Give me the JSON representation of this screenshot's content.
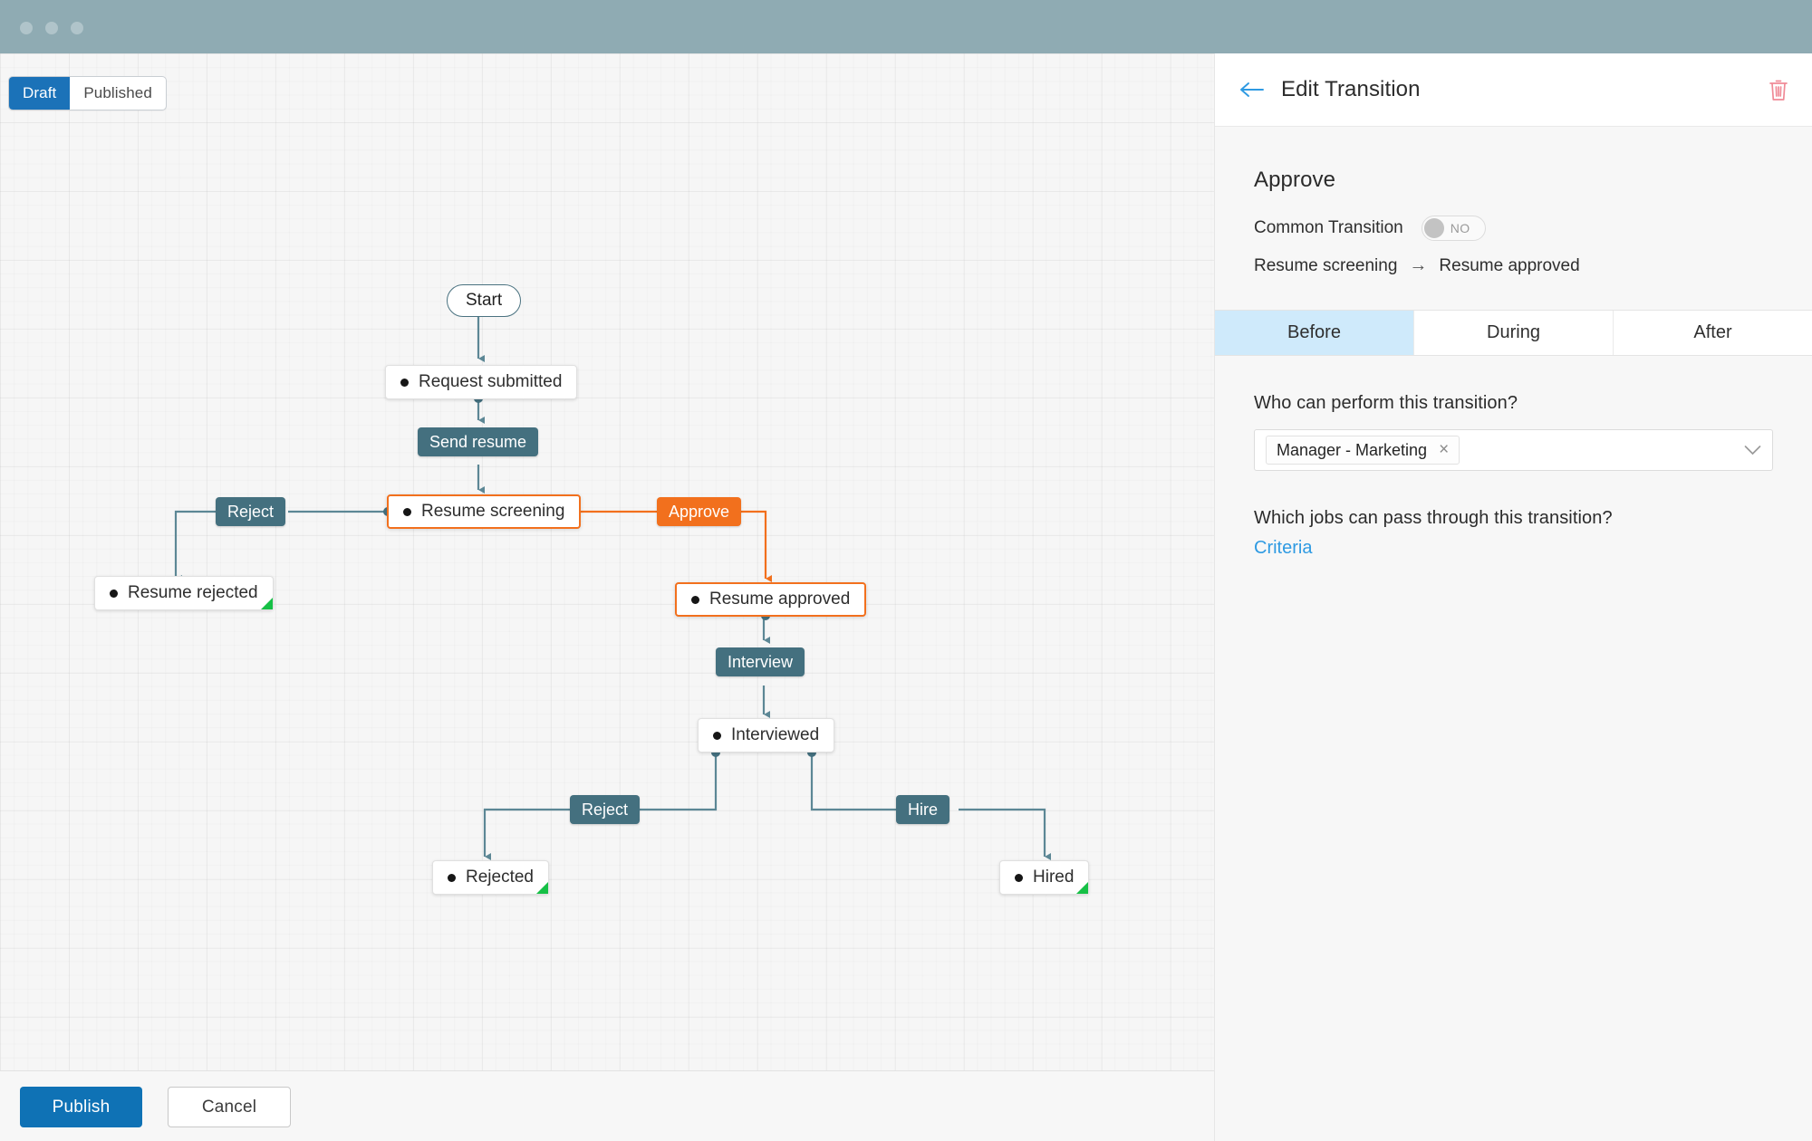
{
  "window": {
    "dots": [
      "close-dot",
      "minimize-dot",
      "maximize-dot"
    ]
  },
  "canvas": {
    "mode_toggle": {
      "draft_label": "Draft",
      "published_label": "Published",
      "selected": "Draft"
    },
    "footer": {
      "publish_label": "Publish",
      "cancel_label": "Cancel"
    }
  },
  "flow": {
    "start": {
      "label": "Start"
    },
    "states": [
      {
        "id": "request-submitted",
        "label": "Request submitted",
        "selected": false,
        "has_green_corner": false
      },
      {
        "id": "resume-screening",
        "label": "Resume screening",
        "selected": true,
        "has_green_corner": false
      },
      {
        "id": "resume-rejected",
        "label": "Resume rejected",
        "selected": false,
        "has_green_corner": true
      },
      {
        "id": "resume-approved",
        "label": "Resume approved",
        "selected": true,
        "has_green_corner": false
      },
      {
        "id": "interviewed",
        "label": "Interviewed",
        "selected": false,
        "has_green_corner": false
      },
      {
        "id": "rejected",
        "label": "Rejected",
        "selected": false,
        "has_green_corner": true
      },
      {
        "id": "hired",
        "label": "Hired",
        "selected": false,
        "has_green_corner": true
      }
    ],
    "transitions": [
      {
        "id": "send-resume",
        "label": "Send resume",
        "selected": false
      },
      {
        "id": "reject-screening",
        "label": "Reject",
        "selected": false
      },
      {
        "id": "approve",
        "label": "Approve",
        "selected": true
      },
      {
        "id": "interview",
        "label": "Interview",
        "selected": false
      },
      {
        "id": "reject-interview",
        "label": "Reject",
        "selected": false
      },
      {
        "id": "hire",
        "label": "Hire",
        "selected": false
      }
    ],
    "colors": {
      "line": "#5c8795",
      "accent": "#f2701d",
      "transition_bg": "#44707f",
      "green_corner": "#16c046"
    }
  },
  "panel": {
    "header": {
      "title": "Edit Transition",
      "back_icon": "back-arrow-icon",
      "delete_icon": "trash-icon"
    },
    "transition_name": "Approve",
    "common_transition": {
      "label": "Common Transition",
      "toggle_value": "NO",
      "enabled": false
    },
    "path": {
      "from": "Resume screening",
      "arrow": "→",
      "to": "Resume approved"
    },
    "tabs": [
      {
        "id": "before",
        "label": "Before",
        "active": true
      },
      {
        "id": "during",
        "label": "During",
        "active": false
      },
      {
        "id": "after",
        "label": "After",
        "active": false
      }
    ],
    "who_question": "Who can perform this transition?",
    "who_value": "Manager - Marketing",
    "who_remove": "×",
    "jobs_question": "Which jobs can pass through this transition?",
    "criteria_link": "Criteria"
  },
  "colors": {
    "titlebar": "#8fabb3",
    "accent_blue": "#0f72b5",
    "tab_active_bg": "#cfeafb",
    "link": "#2e9ae2",
    "orange": "#f2701d"
  }
}
